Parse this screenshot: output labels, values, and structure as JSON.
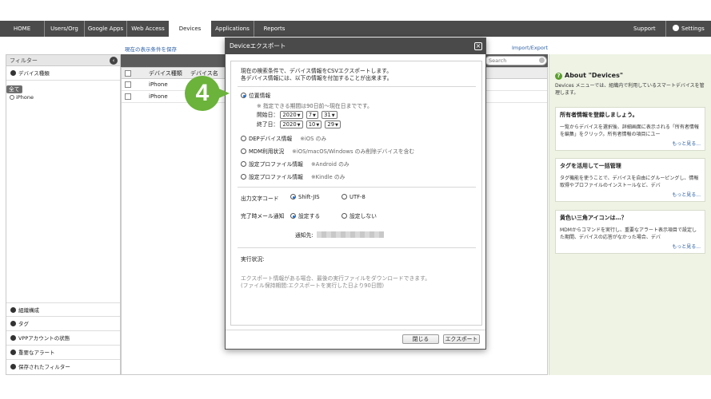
{
  "nav": {
    "items": [
      "HOME",
      "Users/Org",
      "Google Apps",
      "Web Access",
      "Devices",
      "Applications",
      "Reports"
    ],
    "active": "Devices",
    "support": "Support",
    "settings": "Settings"
  },
  "sublinks": {
    "save_view": "現在の表示条件を保存",
    "import_export": "Import/Export"
  },
  "filter": {
    "title": "フィルター",
    "device_type": "デバイス種類",
    "items": [
      "全て",
      "iPhone"
    ],
    "sections": [
      "組織構成",
      "タグ",
      "VPPアカウントの状態",
      "重要なアラート",
      "保存されたフィルター"
    ]
  },
  "table": {
    "col1": "デバイス種類",
    "col2": "デバイス名",
    "rows": [
      "iPhone",
      "iPhone"
    ],
    "search_placeholder": "Search"
  },
  "about": {
    "title": "About \"Devices\"",
    "desc": "Devices メニューでは、組織内で利用しているスマートデバイスを管理します。",
    "cards": [
      {
        "title": "所有者情報を登録しましょう。",
        "text": "一覧からデバイスを選択後、詳細画面に表示される「所有者情報を編集」をクリック。所有者情報の項目にユー",
        "more": "もっと見る..."
      },
      {
        "title": "タグを活用して一括管理",
        "text": "タグ機能を使うことで、デバイスを自由にグルーピングし、情報取得やプロファイルのインストールなど、デバ",
        "more": "もっと見る..."
      },
      {
        "title": "黄色い三角アイコンは…？",
        "text": "MDMからコマンドを実行し、重要なアラート表示項目で設定した期間、デバイスの応答がなかった場合、デバ",
        "more": "もっと見る..."
      }
    ]
  },
  "modal": {
    "title": "Deviceエクスポート",
    "desc1": "現在の検索条件で、デバイス情報をCSVエクスポートします。",
    "desc2": "各デバイス情報には、以下の情報を付加することが出来ます。",
    "location": "位置情報",
    "location_note": "※ 指定できる期間は90日前〜現在日までです。",
    "start_label": "開始日：",
    "end_label": "終了日：",
    "start": {
      "year": "2020",
      "month": "7",
      "day": "31"
    },
    "end": {
      "year": "2020",
      "month": "10",
      "day": "29"
    },
    "options": [
      {
        "label": "DEPデバイス情報",
        "note": "※iOS のみ"
      },
      {
        "label": "MDM利用状況",
        "note": "※iOS/macOS/Windows のみ削除デバイスを含む"
      },
      {
        "label": "設定プロファイル情報",
        "note": "※Android のみ"
      },
      {
        "label": "設定プロファイル情報",
        "note": "※Kindle のみ"
      }
    ],
    "encoding_label": "出力文字コード",
    "encoding_opts": [
      "Shift-JIS",
      "UTF-8"
    ],
    "mail_label": "完了時メール通知",
    "mail_opts": [
      "設定する",
      "設定しない"
    ],
    "notify_label": "通知先:",
    "status_label": "実行状況:",
    "status_text1": "エクスポート情報がある場合、最後の実行ファイルをダウンロードできます。",
    "status_text2": "(ファイル保持期間:エクスポートを実行した日より90日間)",
    "close_btn": "閉じる",
    "export_btn": "エクスポート"
  },
  "step_number": "4"
}
